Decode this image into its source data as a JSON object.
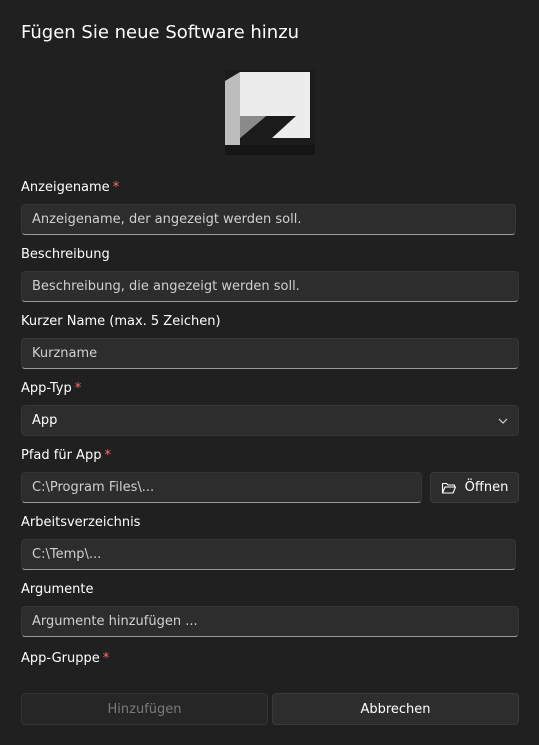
{
  "dialog": {
    "title": "Fügen Sie neue Software hinzu"
  },
  "logo": {
    "icon": "app-placeholder-logo-icon"
  },
  "fields": {
    "display_name": {
      "label": "Anzeigename",
      "required_marker": "*",
      "placeholder": "Anzeigename, der angezeigt werden soll."
    },
    "description": {
      "label": "Beschreibung",
      "placeholder": "Beschreibung, die angezeigt werden soll."
    },
    "short_name": {
      "label": "Kurzer Name (max. 5 Zeichen)",
      "placeholder": "Kurzname"
    },
    "app_type": {
      "label": "App-Typ",
      "required_marker": "*",
      "value": "App"
    },
    "app_path": {
      "label": "Pfad für App",
      "required_marker": "*",
      "placeholder": "C:\\Program Files\\...",
      "open_button": "Öffnen"
    },
    "working_dir": {
      "label": "Arbeitsverzeichnis",
      "placeholder": "C:\\Temp\\..."
    },
    "arguments": {
      "label": "Argumente",
      "placeholder": "Argumente hinzufügen ..."
    },
    "app_group": {
      "label": "App-Gruppe",
      "required_marker": "*"
    }
  },
  "buttons": {
    "add": "Hinzufügen",
    "cancel": "Abbrechen"
  },
  "colors": {
    "background": "#202020",
    "field_bg": "#2d2d2d",
    "required": "#ff6b6b"
  }
}
